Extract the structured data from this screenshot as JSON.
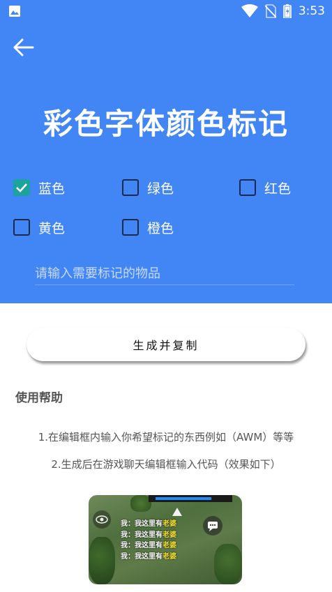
{
  "status_bar": {
    "time": "3:53",
    "icons": [
      "gallery-icon",
      "wifi-icon",
      "no-sim-icon",
      "battery-icon"
    ]
  },
  "header": {
    "back_icon": "arrow-left-icon",
    "title": "彩色字体颜色标记",
    "background": "#4285f4"
  },
  "colors": [
    {
      "label": "蓝色",
      "checked": true
    },
    {
      "label": "绿色",
      "checked": false
    },
    {
      "label": "红色",
      "checked": false
    },
    {
      "label": "黄色",
      "checked": false
    },
    {
      "label": "橙色",
      "checked": false
    }
  ],
  "input": {
    "placeholder": "请输入需要标记的物品",
    "value": ""
  },
  "generate_button": {
    "label": "生成并复制"
  },
  "help": {
    "title": "使用帮助",
    "line1": "1.在编辑框内输入你希望标记的东西例如（AWM）等等",
    "line2": "2.生成后在游戏聊天编辑框输入代码（效果如下）"
  },
  "demo": {
    "chat_lines": [
      {
        "prefix": "我：我这里有",
        "highlight": "老婆"
      },
      {
        "prefix": "我：我这里有",
        "highlight": "老婆"
      },
      {
        "prefix": "我：我这里有",
        "highlight": "老婆"
      },
      {
        "prefix": "我：我这里有",
        "highlight": "老婆"
      }
    ],
    "highlight_color": "#f5e030"
  },
  "accent_check_color": "#1ba39c"
}
